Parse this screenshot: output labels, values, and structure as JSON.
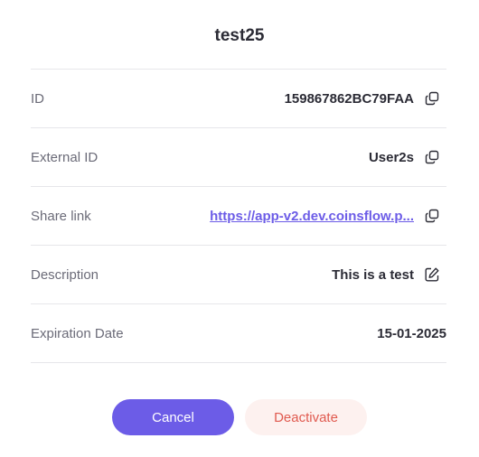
{
  "dialog": {
    "title": "test25"
  },
  "rows": [
    {
      "label": "ID",
      "value": "159867862BC79FAA",
      "action_icon": "copy-icon"
    },
    {
      "label": "External ID",
      "value": "User2s",
      "action_icon": "copy-icon"
    },
    {
      "label": "Share link",
      "value": "https://app-v2.dev.coinsflow.p...",
      "action_icon": "copy-icon"
    },
    {
      "label": "Description",
      "value": "This is a test",
      "action_icon": "edit-icon"
    },
    {
      "label": "Expiration Date",
      "value": "15-01-2025"
    }
  ],
  "buttons": {
    "cancel_label": "Cancel",
    "deactivate_label": "Deactivate"
  },
  "colors": {
    "accent": "#6c5ce7",
    "danger": "#e05a4f",
    "danger_bg": "#fdf1ef",
    "text": "#2b2b35",
    "muted": "#6b6b78",
    "divider": "#e6e6ea"
  }
}
